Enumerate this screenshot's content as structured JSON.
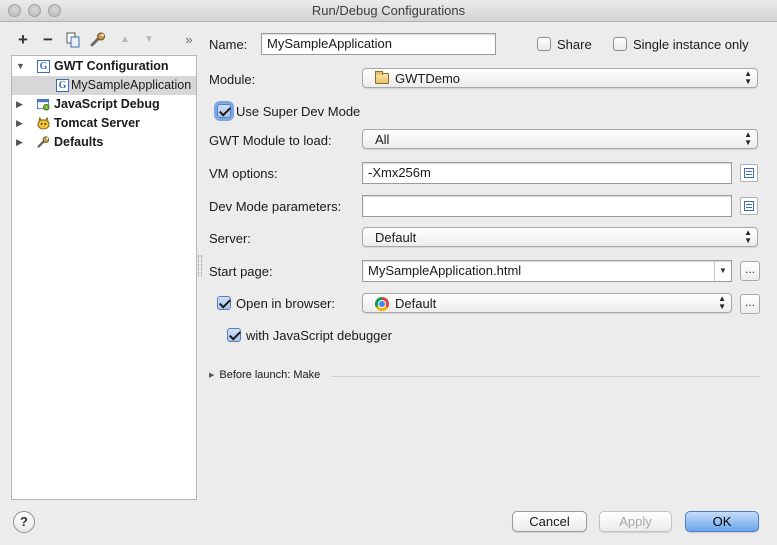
{
  "window": {
    "title": "Run/Debug Configurations"
  },
  "toolbar": {
    "add": "+",
    "remove": "−",
    "copy_icon": "copy-icon",
    "edit_defaults_icon": "wrench-icon",
    "move_up": "▲",
    "move_down": "▼",
    "more": "»"
  },
  "tree": {
    "items": [
      {
        "label": "GWT Configuration",
        "expanded": true,
        "icon": "gwt-icon"
      },
      {
        "label": "MySampleApplication",
        "selected": true,
        "icon": "gwt-icon"
      },
      {
        "label": "JavaScript Debug",
        "expanded": false,
        "icon": "javascript-debug-icon"
      },
      {
        "label": "Tomcat Server",
        "expanded": false,
        "icon": "tomcat-icon"
      },
      {
        "label": "Defaults",
        "expanded": false,
        "icon": "wrench-icon"
      }
    ]
  },
  "form": {
    "name_label": "Name:",
    "name_value": "MySampleApplication",
    "share_label": "Share",
    "single_instance_label": "Single instance only",
    "module_label": "Module:",
    "module_value": "GWTDemo",
    "super_dev_label": "Use Super Dev Mode",
    "gwt_module_label": "GWT Module to load:",
    "gwt_module_value": "All",
    "vm_options_label": "VM options:",
    "vm_options_value": "-Xmx256m",
    "dev_mode_label": "Dev Mode parameters:",
    "dev_mode_value": "",
    "server_label": "Server:",
    "server_value": "Default",
    "start_page_label": "Start page:",
    "start_page_value": "MySampleApplication.html",
    "open_browser_label": "Open in browser:",
    "browser_value": "Default",
    "js_debugger_label": "with JavaScript debugger",
    "before_launch": "Before launch: Make",
    "ellipsis": "..."
  },
  "checkboxes": {
    "share": false,
    "single_instance": false,
    "super_dev": true,
    "open_browser": true,
    "js_debugger": true
  },
  "buttons": {
    "help": "?",
    "cancel": "Cancel",
    "apply": "Apply",
    "ok": "OK"
  },
  "colors": {
    "accent": "#6aa6ec",
    "focus_ring": "#7aa7e6",
    "gwt_blue": "#3b6fb5"
  }
}
